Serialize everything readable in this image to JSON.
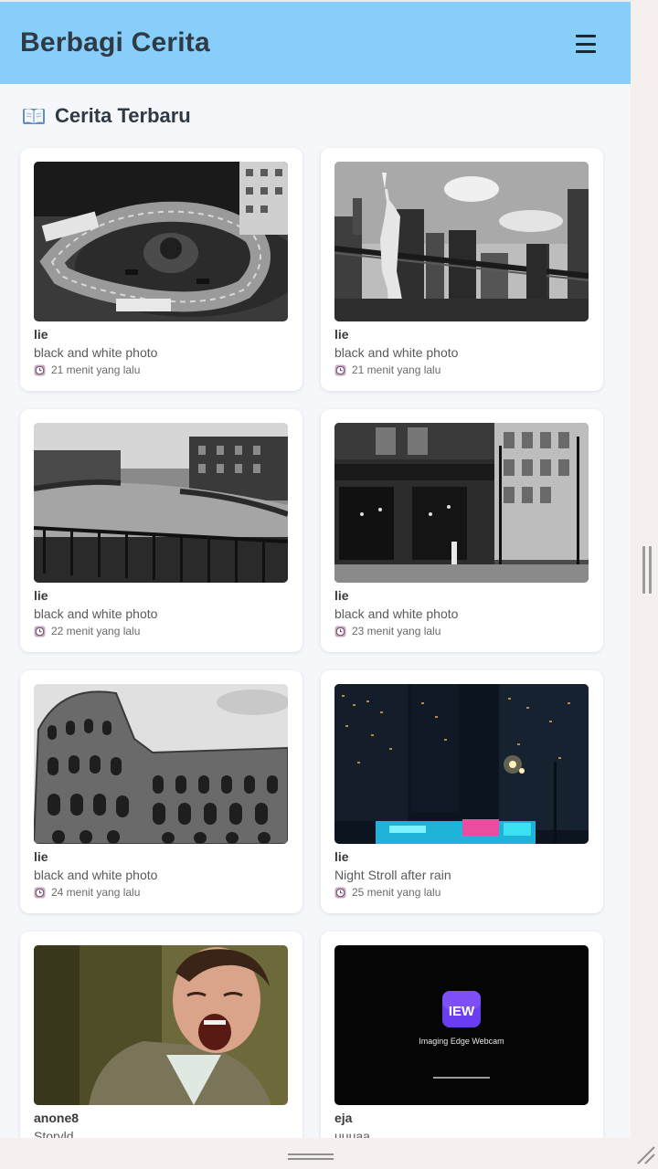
{
  "header": {
    "title": "Berbagi Cerita",
    "menu_icon": "hamburger-menu-icon"
  },
  "section": {
    "icon": "open-book-icon",
    "title": "Cerita Terbaru"
  },
  "colors": {
    "appbar": "#87cefa",
    "page": "#f5f7fb",
    "card": "#ffffff"
  },
  "stories": [
    {
      "author": "lie",
      "description": "black and white photo",
      "time": "21 menit yang lalu",
      "image": "race-circuit-bw"
    },
    {
      "author": "lie",
      "description": "black and white photo",
      "time": "21 menit yang lalu",
      "image": "statue-of-liberty-bw"
    },
    {
      "author": "lie",
      "description": "black and white photo",
      "time": "22 menit yang lalu",
      "image": "canal-bridge-bw"
    },
    {
      "author": "lie",
      "description": "black and white photo",
      "time": "23 menit yang lalu",
      "image": "tavern-street-bw"
    },
    {
      "author": "lie",
      "description": "black and white photo",
      "time": "24 menit yang lalu",
      "image": "colosseum-bw"
    },
    {
      "author": "lie",
      "description": "Night Stroll after rain",
      "time": "25 menit yang lalu",
      "image": "city-night"
    },
    {
      "author": "anone8",
      "description": "Storyld",
      "time": "",
      "image": "screaming-man"
    },
    {
      "author": "eja",
      "description": "uuuaa",
      "time": "",
      "image": "webcam-app-splash",
      "image_texts": {
        "logo": "IEW",
        "app_name": "Imaging Edge Webcam"
      }
    }
  ]
}
